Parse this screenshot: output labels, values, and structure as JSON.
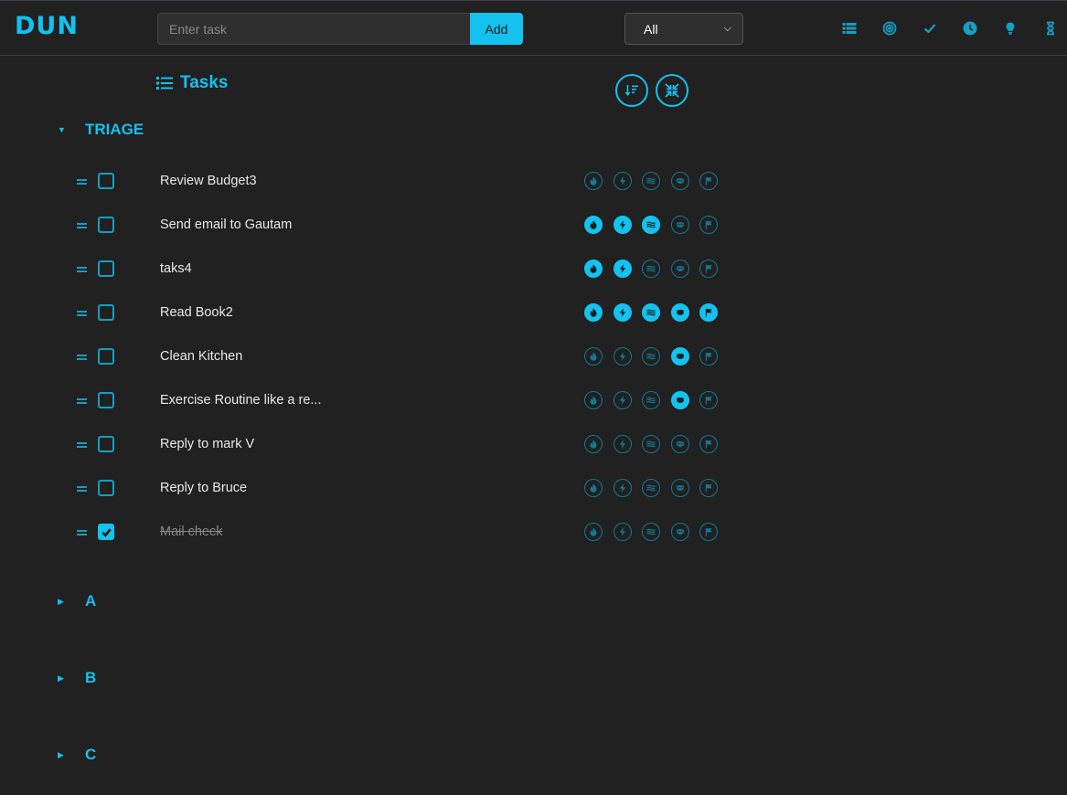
{
  "app": {
    "logo": "DUN"
  },
  "header": {
    "input_placeholder": "Enter task",
    "input_value": "",
    "add_label": "Add",
    "filter_selected": "All",
    "nav_icons": [
      "list-icon",
      "target-icon",
      "check-icon",
      "clock-icon",
      "lightbulb-icon",
      "hourglass-icon"
    ]
  },
  "toolbar": {
    "title": "Tasks",
    "sort_button_icon": "sort-icon",
    "collapse_button_icon": "collapse-icon"
  },
  "accent_color": "#13c2ef",
  "sections": [
    {
      "name": "TRIAGE",
      "expanded": true
    },
    {
      "name": "A",
      "expanded": false
    },
    {
      "name": "B",
      "expanded": false
    },
    {
      "name": "C",
      "expanded": false
    }
  ],
  "tag_icons": [
    "flame-icon",
    "bolt-icon",
    "waves-icon",
    "mask-icon",
    "flag-icon"
  ],
  "tasks": [
    {
      "text": "Review Budget3",
      "done": false,
      "tags": [
        false,
        false,
        false,
        false,
        false
      ]
    },
    {
      "text": "Send email to Gautam",
      "done": false,
      "tags": [
        true,
        true,
        true,
        false,
        false
      ]
    },
    {
      "text": "taks4",
      "done": false,
      "tags": [
        true,
        true,
        false,
        false,
        false
      ]
    },
    {
      "text": "Read Book2",
      "done": false,
      "tags": [
        true,
        true,
        true,
        true,
        true
      ]
    },
    {
      "text": "Clean Kitchen",
      "done": false,
      "tags": [
        false,
        false,
        false,
        true,
        false
      ]
    },
    {
      "text": "Exercise Routine like a re...",
      "done": false,
      "tags": [
        false,
        false,
        false,
        true,
        false
      ]
    },
    {
      "text": "Reply to mark V",
      "done": false,
      "tags": [
        false,
        false,
        false,
        false,
        false
      ]
    },
    {
      "text": "Reply to Bruce",
      "done": false,
      "tags": [
        false,
        false,
        false,
        false,
        false
      ]
    },
    {
      "text": "Mail check",
      "done": true,
      "tags": [
        false,
        false,
        false,
        false,
        false
      ]
    }
  ]
}
